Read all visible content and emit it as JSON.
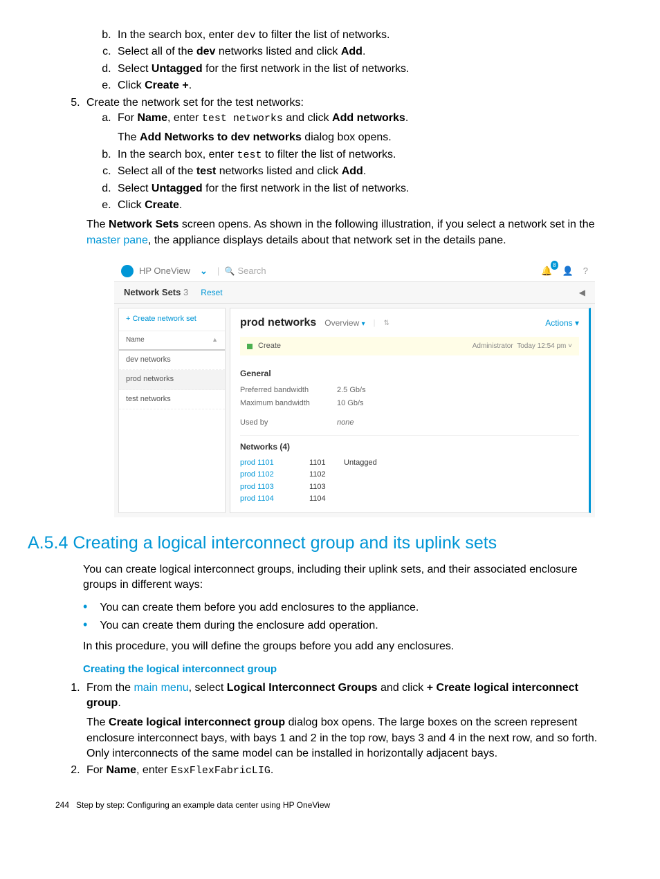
{
  "list4": {
    "b": {
      "pre": "In the search box, enter ",
      "code": "dev",
      "post": " to filter the list of networks."
    },
    "c": {
      "pre": "Select all of the ",
      "bold": "dev",
      "post": " networks listed and click ",
      "bold2": "Add",
      "post2": "."
    },
    "d": {
      "pre": "Select ",
      "bold": "Untagged",
      "post": " for the first network in the list of networks."
    },
    "e": {
      "pre": "Click ",
      "bold": "Create +",
      "post": "."
    }
  },
  "step5": {
    "intro": "Create the network set for the test networks:",
    "a": {
      "pre": "For ",
      "bold": "Name",
      "mid": ", enter ",
      "code": "test networks",
      "mid2": " and click ",
      "bold2": "Add networks",
      "post": "."
    },
    "a_after": {
      "pre": "The ",
      "bold": "Add Networks to dev networks",
      "post": " dialog box opens."
    },
    "b": {
      "pre": "In the search box, enter ",
      "code": "test",
      "post": " to filter the list of networks."
    },
    "c": {
      "pre": "Select all of the ",
      "bold": "test",
      "post": " networks listed and click ",
      "bold2": "Add",
      "post2": "."
    },
    "d": {
      "pre": "Select ",
      "bold": "Untagged",
      "post": " for the first network in the list of networks."
    },
    "e": {
      "pre": "Click ",
      "bold": "Create",
      "post": "."
    }
  },
  "ns_para": {
    "pre": "The ",
    "bold": "Network Sets",
    "mid": " screen opens. As shown in the following illustration, if you select a network set in the ",
    "link": "master pane",
    "post": ", the appliance displays details about that network set in the details pane."
  },
  "shot": {
    "brand": "HP OneView",
    "search_placeholder": "Search",
    "badge": "8",
    "help": "?",
    "subbar": {
      "title": "Network Sets",
      "count": "3",
      "reset": "Reset",
      "collapse": "◀"
    },
    "left": {
      "create": "+ Create network set",
      "name_hdr": "Name",
      "sort_glyph": "▲",
      "rows": [
        "dev networks",
        "prod networks",
        "test networks"
      ]
    },
    "right": {
      "title": "prod networks",
      "overview": "Overview",
      "actions": "Actions",
      "strip": {
        "create": "Create",
        "user": "Administrator",
        "time": "Today 12:54 pm ˅"
      },
      "general": "General",
      "kv": [
        {
          "k": "Preferred bandwidth",
          "v": "2.5 Gb/s"
        },
        {
          "k": "Maximum bandwidth",
          "v": "10 Gb/s"
        },
        {
          "k": "Used by",
          "v": "none"
        }
      ],
      "networks_hdr": "Networks (4)",
      "networks": [
        {
          "name": "prod 1101",
          "vlan": "1101",
          "tag": "Untagged"
        },
        {
          "name": "prod 1102",
          "vlan": "1102",
          "tag": ""
        },
        {
          "name": "prod 1103",
          "vlan": "1103",
          "tag": ""
        },
        {
          "name": "prod 1104",
          "vlan": "1104",
          "tag": ""
        }
      ]
    }
  },
  "a54": {
    "heading": "A.5.4 Creating a logical interconnect group and its uplink sets",
    "p1": "You can create logical interconnect groups, including their uplink sets, and their associated enclosure groups in different ways:",
    "b1": "You can create them before you add enclosures to the appliance.",
    "b2": "You can create them during the enclosure add operation.",
    "p2": "In this procedure, you will define the groups before you add any enclosures.",
    "subhead": "Creating the logical interconnect group",
    "s1": {
      "pre": "From the ",
      "link": "main menu",
      "mid": ", select ",
      "bold": "Logical Interconnect Groups",
      "mid2": " and click ",
      "bold2": "+ Create logical interconnect group",
      "post": "."
    },
    "s1_after": {
      "pre": "The ",
      "bold": "Create logical interconnect group",
      "post": " dialog box opens. The large boxes on the screen represent enclosure interconnect bays, with bays 1 and 2 in the top row, bays 3 and 4 in the next row, and so forth. Only interconnects of the same model can be installed in horizontally adjacent bays."
    },
    "s2": {
      "pre": "For ",
      "bold": "Name",
      "mid": ", enter ",
      "code": "EsxFlexFabricLIG",
      "post": "."
    }
  },
  "footer": {
    "page": "244",
    "text": "Step by step: Configuring an example data center using HP OneView"
  }
}
